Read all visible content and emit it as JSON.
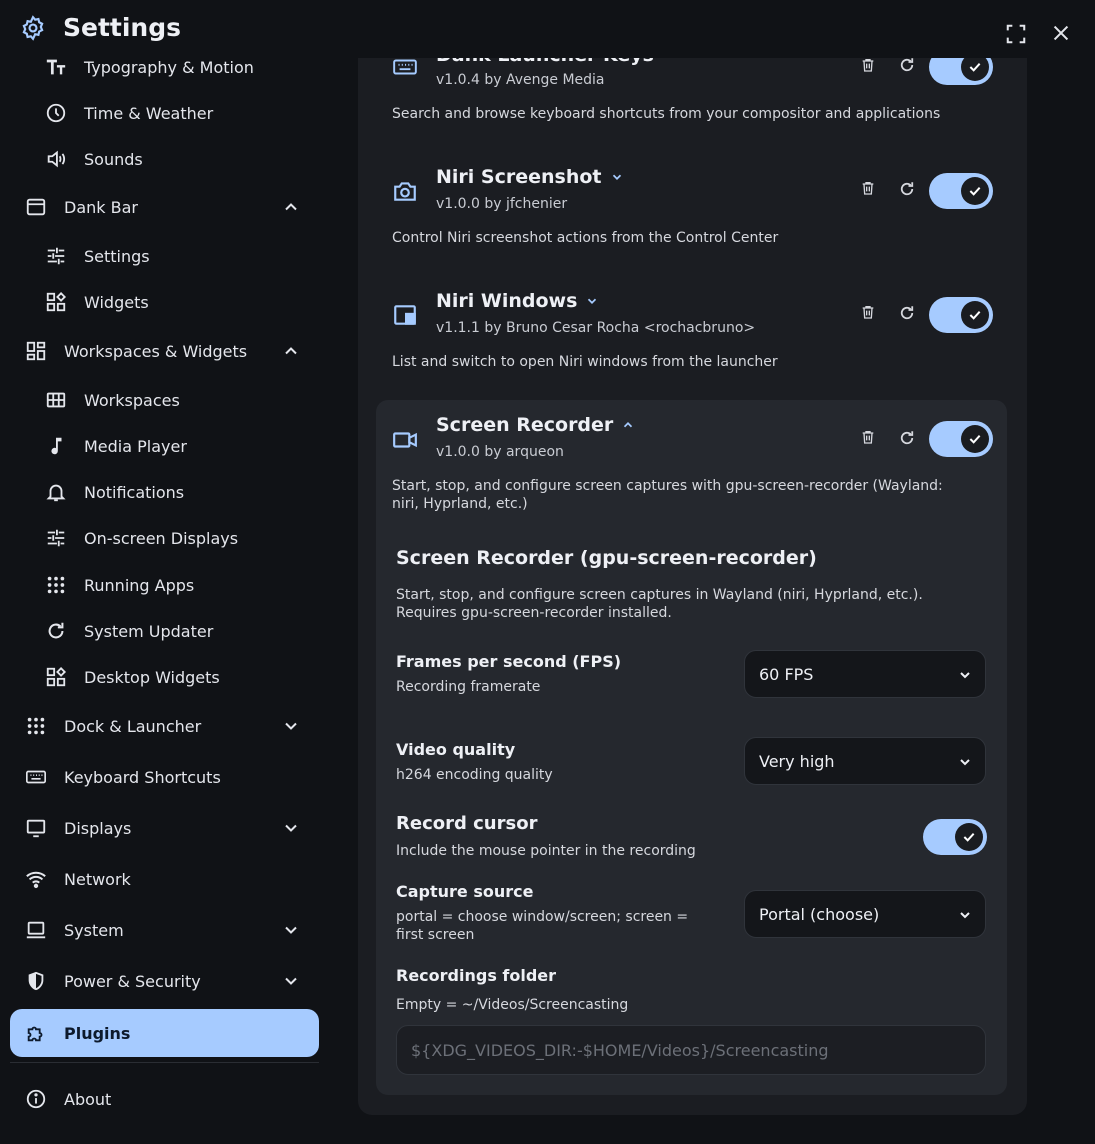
{
  "header": {
    "title": "Settings"
  },
  "sidebar": {
    "items": [
      {
        "label": "Typography & Motion"
      },
      {
        "label": "Time & Weather"
      },
      {
        "label": "Sounds"
      },
      {
        "label": "Dank Bar"
      },
      {
        "label": "Settings"
      },
      {
        "label": "Widgets"
      },
      {
        "label": "Workspaces & Widgets"
      },
      {
        "label": "Workspaces"
      },
      {
        "label": "Media Player"
      },
      {
        "label": "Notifications"
      },
      {
        "label": "On-screen Displays"
      },
      {
        "label": "Running Apps"
      },
      {
        "label": "System Updater"
      },
      {
        "label": "Desktop Widgets"
      },
      {
        "label": "Dock & Launcher"
      },
      {
        "label": "Keyboard Shortcuts"
      },
      {
        "label": "Displays"
      },
      {
        "label": "Network"
      },
      {
        "label": "System"
      },
      {
        "label": "Power & Security"
      },
      {
        "label": "Plugins"
      },
      {
        "label": "About"
      }
    ]
  },
  "plugins": [
    {
      "name": "Dank Launcher Keys",
      "version": "v1.0.4 by Avenge Media",
      "description": "Search and browse keyboard shortcuts from your compositor and applications"
    },
    {
      "name": "Niri Screenshot",
      "version": "v1.0.0 by jfchenier",
      "description": "Control Niri screenshot actions from the Control Center"
    },
    {
      "name": "Niri Windows",
      "version": "v1.1.1 by Bruno Cesar Rocha <rochacbruno>",
      "description": "List and switch to open Niri windows from the launcher"
    },
    {
      "name": "Screen Recorder",
      "version": "v1.0.0 by arqueon",
      "description": "Start, stop, and configure screen captures with gpu-screen-recorder (Wayland: niri, Hyprland, etc.)"
    }
  ],
  "recorder": {
    "title": "Screen Recorder (gpu-screen-recorder)",
    "description": "Start, stop, and configure screen captures in Wayland (niri, Hyprland, etc.). Requires gpu-screen-recorder installed.",
    "fps": {
      "label": "Frames per second (FPS)",
      "sub": "Recording framerate",
      "value": "60 FPS"
    },
    "quality": {
      "label": "Video quality",
      "sub": "h264 encoding quality",
      "value": "Very high"
    },
    "cursor": {
      "label": "Record cursor",
      "sub": "Include the mouse pointer in the recording"
    },
    "source": {
      "label": "Capture source",
      "sub": "portal = choose window/screen; screen = first screen",
      "value": "Portal (choose)"
    },
    "folder": {
      "label": "Recordings folder",
      "sub": "Empty = ~/Videos/Screencasting",
      "placeholder": "${XDG_VIDEOS_DIR:-$HOME/Videos}/Screencasting"
    }
  },
  "colors": {
    "accent": "#a6cbff",
    "background": "#101216",
    "panel": "#1b1d22",
    "card": "#25282e"
  }
}
